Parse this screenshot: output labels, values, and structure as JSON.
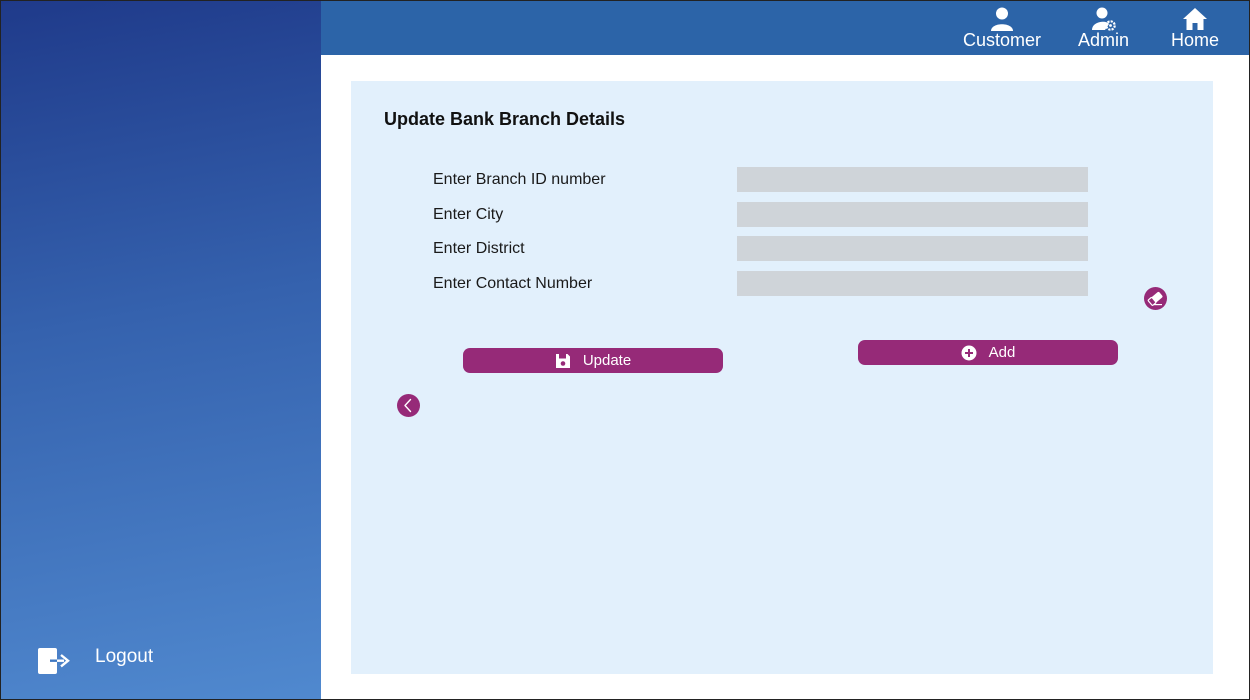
{
  "sidebar": {
    "logout_label": "Logout",
    "logout_icon": "logout-icon"
  },
  "topnav": {
    "items": [
      {
        "label": "Customer",
        "icon": "user-icon"
      },
      {
        "label": "Admin",
        "icon": "user-gear-icon"
      },
      {
        "label": "Home",
        "icon": "home-icon"
      }
    ]
  },
  "form": {
    "title": "Update Bank Branch Details",
    "fields": [
      {
        "label": "Enter Branch ID number",
        "value": ""
      },
      {
        "label": "Enter City",
        "value": ""
      },
      {
        "label": "Enter District",
        "value": ""
      },
      {
        "label": "Enter Contact Number",
        "value": ""
      }
    ],
    "update_label": "Update",
    "add_label": "Add",
    "clear_icon": "eraser-icon",
    "back_icon": "chevron-left-icon"
  },
  "colors": {
    "sidebar_top": "#1f3a8a",
    "sidebar_bottom": "#5089cf",
    "topbar": "#2c64a8",
    "panel": "#e2f0fc",
    "input": "#cfd4d9",
    "accent": "#962a78"
  }
}
